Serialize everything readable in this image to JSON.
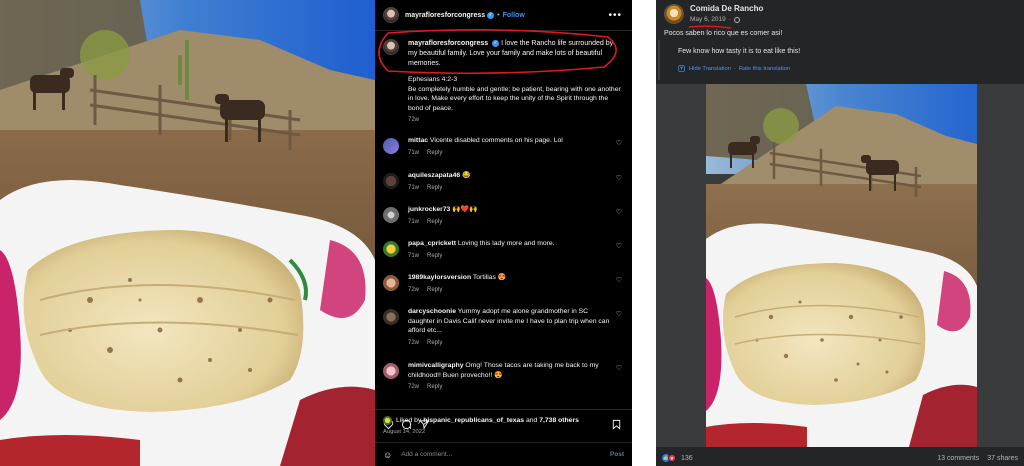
{
  "instagram": {
    "username": "mayrafloresforcongress",
    "follow_label": "Follow",
    "more_label": "•••",
    "caption": {
      "username": "mayrafloresforcongress",
      "text": "I love the Rancho life surrounded by my beautiful family. Love your family and make lots of beautiful memories.",
      "scripture_ref": "Ephesians 4:2-3",
      "scripture_text": "Be completely humble and gentle; be patient, bearing with one another in love. Make every effort to keep the unity of the Spirit through the bond of peace.",
      "age": "72w"
    },
    "comments": [
      {
        "user": "mittac",
        "text": "Vicente disabled comments on his page. Lol",
        "age": "71w",
        "reply": "Reply"
      },
      {
        "user": "aquileszapata46",
        "text": "😂",
        "age": "71w",
        "reply": "Reply"
      },
      {
        "user": "junkrocker73",
        "text": "🙌❤️🙌",
        "age": "71w",
        "reply": "Reply"
      },
      {
        "user": "papa_cprickett",
        "text": "Loving this lady more and more.",
        "age": "71w",
        "reply": "Reply"
      },
      {
        "user": "1989kaylorsversion",
        "text": "Tortillas 😍",
        "age": "72w",
        "reply": "Reply"
      },
      {
        "user": "darcyschoonie",
        "text": "Yummy adopt me alone grandmother in SC daughter in Davis Calif never invite me I have to plan trip when can afford etc...",
        "age": "72w",
        "reply": "Reply"
      },
      {
        "user": "mimivcalligraphy",
        "text": "Omg! Those tacos are taking me back to my childhood!! Buen provecho!! 😍",
        "age": "72w",
        "reply": "Reply"
      }
    ],
    "liked_by_prefix": "Liked by",
    "liked_by_user": "hispanic_republicans_of_texas",
    "liked_by_and": "and",
    "liked_by_count": "7,738 others",
    "date": "August 14, 2022",
    "add_comment_placeholder": "Add a comment...",
    "post_label": "Post"
  },
  "facebook": {
    "page_name": "Comida De Rancho",
    "date": "May 6, 2019",
    "date_sep": "·",
    "post_text": "Pocos saben lo rico que es comer asi!",
    "translation": "Few know how tasty it is to eat like this!",
    "hide_translation": "Hide Translation",
    "rate_translation": "Rate this translation",
    "link_sep": "·",
    "reaction_count": "136",
    "comments_count": "13 comments",
    "shares_count": "37 shares"
  },
  "colors": {
    "ig_bg": "#000000",
    "fb_bg": "#242526",
    "link_blue": "#3897f0",
    "annotation_red": "#e0191f"
  }
}
